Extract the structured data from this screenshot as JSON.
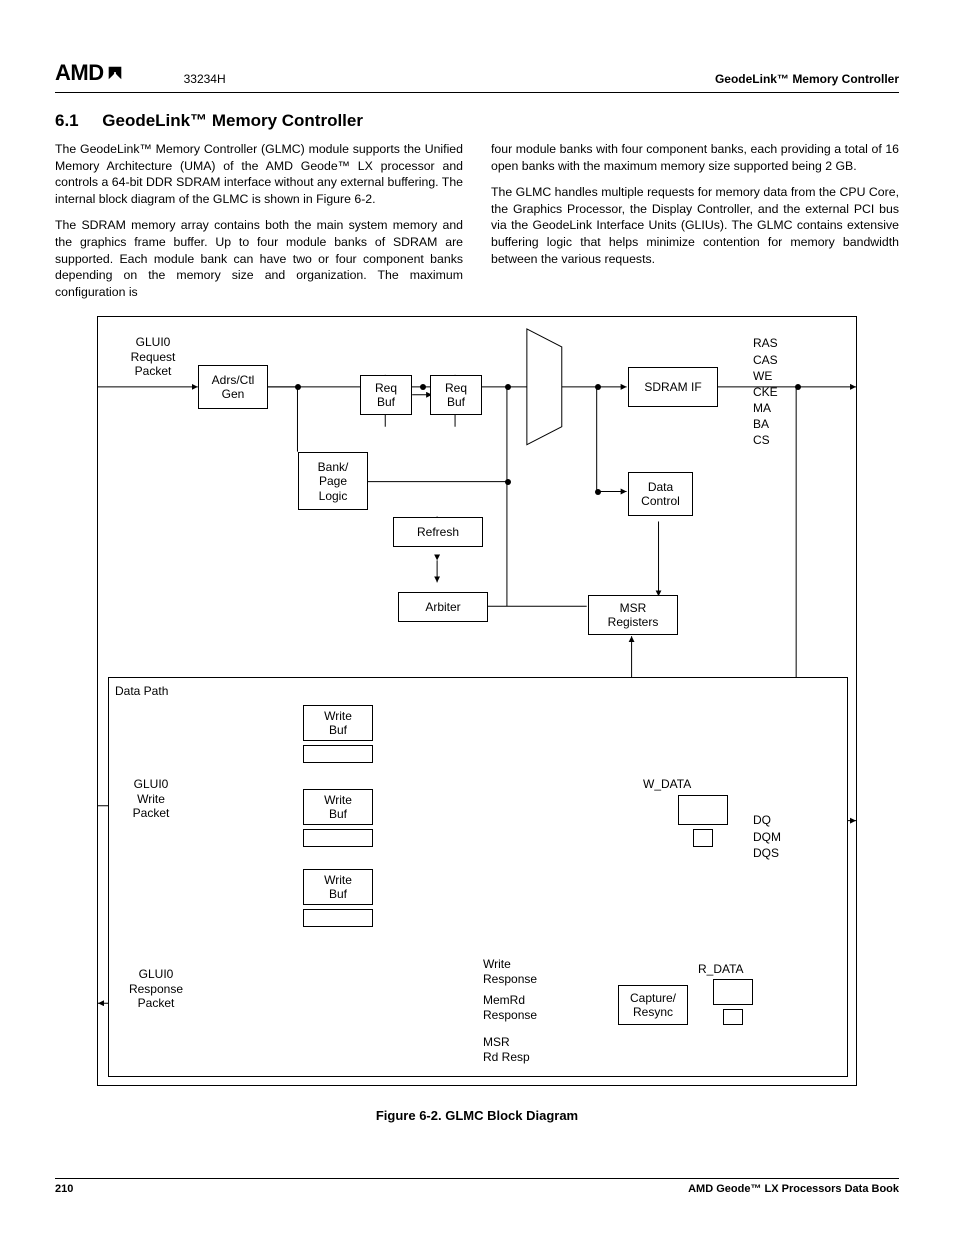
{
  "header": {
    "logo_text": "AMD",
    "doc_number": "33234H",
    "right": "GeodeLink™ Memory Controller"
  },
  "section": {
    "number": "6.1",
    "title": "GeodeLink™ Memory Controller"
  },
  "body": {
    "p1": "The GeodeLink™ Memory Controller (GLMC) module supports the Unified Memory Architecture (UMA) of the AMD Geode™ LX processor and controls a 64-bit DDR SDRAM interface without any external buffering. The internal block diagram of the GLMC is shown in Figure 6-2.",
    "p2": "The SDRAM memory array contains both the main system memory and the graphics frame buffer. Up to four module banks of SDRAM are supported. Each module bank can have two or four component banks depending on the memory size and organization. The maximum configuration is",
    "p3": "four module banks with four component banks, each providing a total of 16 open banks with the maximum memory size supported being 2 GB.",
    "p4": "The GLMC handles multiple requests for memory data from the CPU Core, the Graphics Processor, the Display Controller, and the external PCI bus via the GeodeLink Interface Units (GLIUs). The GLMC contains extensive buffering logic that helps minimize contention for memory bandwidth between the various requests."
  },
  "diagram": {
    "glui0_req": "GLUI0\nRequest\nPacket",
    "adrs_ctl": "Adrs/Ctl\nGen",
    "req_buf": "Req\nBuf",
    "bank_page": "Bank/\nPage\nLogic",
    "refresh": "Refresh",
    "arbiter": "Arbiter",
    "sdram_if": "SDRAM IF",
    "data_control": "Data\nControl",
    "msr_reg": "MSR\nRegisters",
    "signals_top": "RAS\nCAS\nWE\nCKE\nMA\nBA\nCS",
    "data_path": "Data Path",
    "write_buf": "Write\nBuf",
    "glui0_write": "GLUI0\nWrite\nPacket",
    "w_data": "W_DATA",
    "dq": "DQ\nDQM\nDQS",
    "glui0_resp": "GLUI0\nResponse\nPacket",
    "write_resp": "Write\nResponse",
    "memrd_resp": "MemRd\nResponse",
    "msr_rd": "MSR\nRd Resp",
    "capture": "Capture/\nResync",
    "r_data": "R_DATA"
  },
  "figure_caption": "Figure 6-2.  GLMC Block Diagram",
  "footer": {
    "page": "210",
    "book": "AMD Geode™ LX Processors Data Book"
  }
}
